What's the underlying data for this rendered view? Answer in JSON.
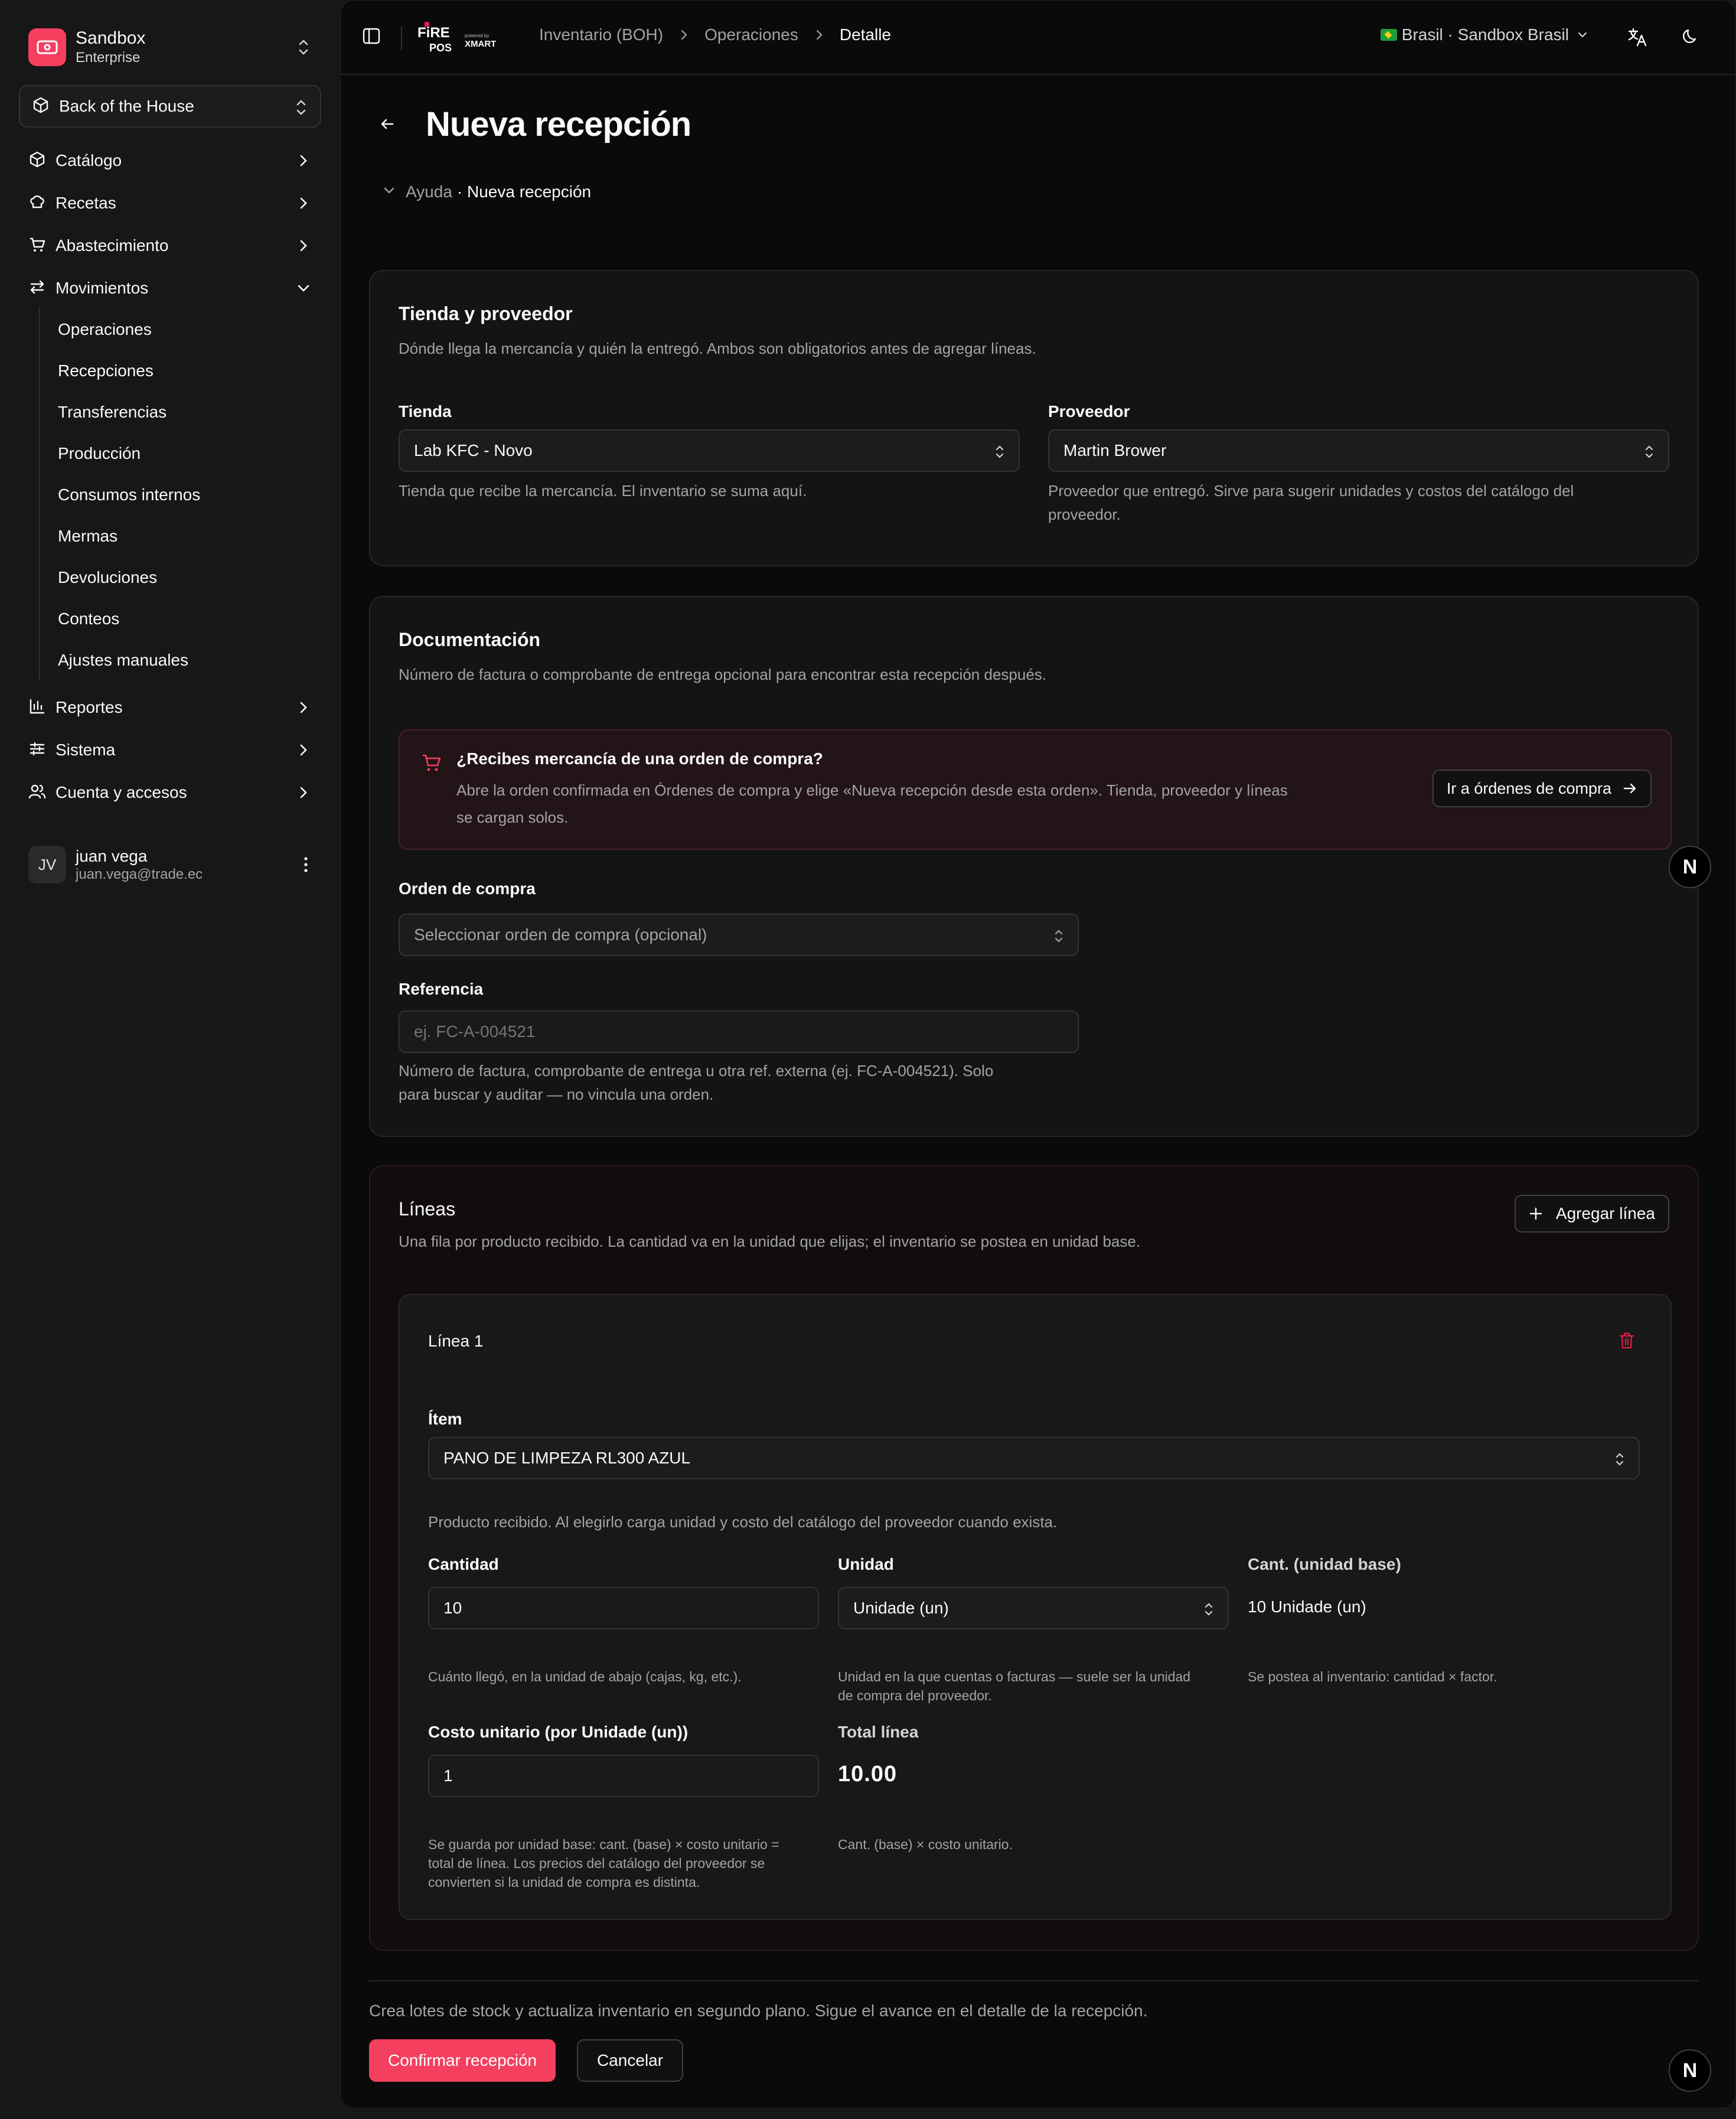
{
  "sidebar": {
    "brand_name": "Sandbox",
    "brand_plan": "Enterprise",
    "store": "Back of the House",
    "nav": [
      {
        "label": "Catálogo",
        "icon": "box-icon"
      },
      {
        "label": "Recetas",
        "icon": "chef-hat-icon"
      },
      {
        "label": "Abastecimiento",
        "icon": "cart-icon"
      },
      {
        "label": "Movimientos",
        "icon": "arrows-icon"
      }
    ],
    "subnav": [
      "Operaciones",
      "Recepciones",
      "Transferencias",
      "Producción",
      "Consumos internos",
      "Mermas",
      "Devoluciones",
      "Conteos",
      "Ajustes manuales"
    ],
    "nav_bottom": [
      {
        "label": "Reportes",
        "icon": "bar-chart-icon"
      },
      {
        "label": "Sistema",
        "icon": "sliders-icon"
      },
      {
        "label": "Cuenta y accesos",
        "icon": "users-icon"
      }
    ],
    "user": {
      "initials": "JV",
      "name": "juan vega",
      "email": "juan.vega@trade.ec"
    }
  },
  "topbar": {
    "breadcrumb": [
      "Inventario (BOH)",
      "Operaciones",
      "Detalle"
    ],
    "country": "Brasil · Sandbox Brasil"
  },
  "page": {
    "title": "Nueva recepción",
    "help_prefix": "Ayuda",
    "help_title": "· Nueva recepción"
  },
  "store_supplier": {
    "title": "Tienda y proveedor",
    "description": "Dónde llega la mercancía y quién la entregó. Ambos son obligatorios antes de agregar líneas.",
    "store_label": "Tienda",
    "store_value": "Lab KFC - Novo",
    "store_help": "Tienda que recibe la mercancía. El inventario se suma aquí.",
    "supplier_label": "Proveedor",
    "supplier_value": "Martin Brower",
    "supplier_help_1": "Proveedor que entregó. Sirve para sugerir unidades y costos del catálogo del",
    "supplier_help_2": "proveedor."
  },
  "documentation": {
    "title": "Documentación",
    "description": "Número de factura o comprobante de entrega opcional para encontrar esta recepción después.",
    "alert_title": "¿Recibes mercancía de una orden de compra?",
    "alert_body_1": "Abre la orden confirmada en Órdenes de compra y elige «Nueva recepción desde esta orden». Tienda, proveedor y líneas",
    "alert_body_2": "se cargan solos.",
    "alert_button": "Ir a órdenes de compra",
    "po_label": "Orden de compra",
    "po_placeholder": "Seleccionar orden de compra (opcional)",
    "ref_label": "Referencia",
    "ref_placeholder": "ej. FC-A-004521",
    "ref_help_1": "Número de factura, comprobante de entrega u otra ref. externa (ej. FC-A-004521). Solo",
    "ref_help_2": "para buscar y auditar — no vincula una orden."
  },
  "lines": {
    "title": "Líneas",
    "description": "Una fila por producto recibido. La cantidad va en la unidad que elijas; el inventario se postea en unidad base.",
    "add_button": "Agregar línea",
    "line": {
      "title": "Línea 1",
      "item_label": "Ítem",
      "item_value": "PANO DE LIMPEZA RL300 AZUL",
      "item_help": "Producto recibido. Al elegirlo carga unidad y costo del catálogo del proveedor cuando exista.",
      "qty_label": "Cantidad",
      "qty_value": "10",
      "qty_help": "Cuánto llegó, en la unidad de abajo (cajas, kg, etc.).",
      "unit_label": "Unidad",
      "unit_value": "Unidade (un)",
      "unit_help_1": "Unidad en la que cuentas o facturas — suele ser la unidad",
      "unit_help_2": "de compra del proveedor.",
      "base_label": "Cant. (unidad base)",
      "base_value": "10 Unidade (un)",
      "base_help": "Se postea al inventario: cantidad × factor.",
      "cost_label": "Costo unitario (por Unidade (un))",
      "cost_value": "1",
      "cost_help_1": "Se guarda por unidad base: cant. (base) × costo unitario =",
      "cost_help_2": "total de línea. Los precios del catálogo del proveedor se",
      "cost_help_3": "convierten si la unidad de compra es distinta.",
      "total_label": "Total línea",
      "total_value": "10.00",
      "total_help": "Cant. (base) × costo unitario."
    }
  },
  "footer": {
    "note": "Crea lotes de stock y actualiza inventario en segundo plano. Sigue el avance en el detalle de la recepción.",
    "confirm": "Confirmar recepción",
    "cancel": "Cancelar"
  },
  "badge": "N",
  "colors": {
    "accent": "#f43f5e",
    "background": "#0a0a0a",
    "card": "#141414"
  }
}
